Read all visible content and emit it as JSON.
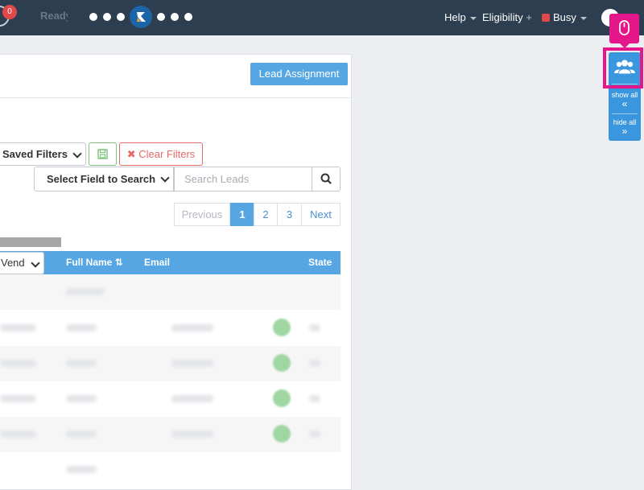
{
  "topbar": {
    "notification_count": "0",
    "brand_text": "Ready",
    "nav": {
      "help": "Help",
      "eligibility": "Eligibility",
      "eligibility_suffix": "+",
      "busy": "Busy"
    }
  },
  "panel": {
    "lead_assignment_button": "Lead Assignment",
    "filters": {
      "saved_filters": "Saved Filters",
      "clear_filters": "Clear Filters"
    },
    "search": {
      "field_select": "Select Field to Search",
      "placeholder": "Search Leads"
    },
    "pagination": {
      "previous": "Previous",
      "pages": [
        "1",
        "2",
        "3"
      ],
      "active_page": "1",
      "next": "Next"
    },
    "table": {
      "vendor_select": "Vend",
      "columns": {
        "full_name": "Full Name",
        "sort_icon": "⇅",
        "email": "Email",
        "state": "State"
      }
    }
  },
  "sidebar": {
    "show_all": "show all",
    "show_all_arrow": "«",
    "hide_all": "hide all",
    "hide_all_arrow": "»"
  },
  "colors": {
    "topbar": "#2d3e50",
    "accent": "#55a6e3",
    "sidetab": "#3b97dd",
    "highlight": "#e5168a",
    "danger": "#e46a6a",
    "success": "#7dc57d"
  }
}
